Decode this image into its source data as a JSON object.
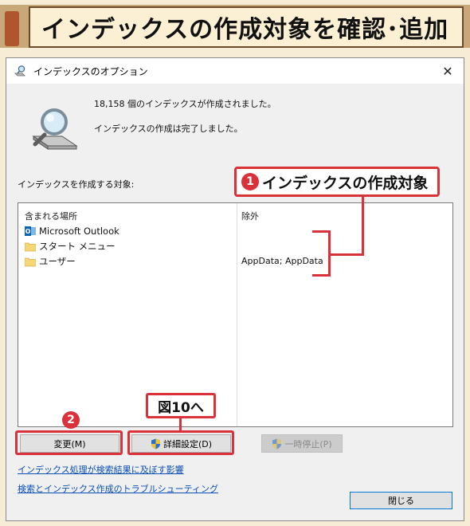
{
  "header": {
    "title": "インデックスの作成対象を確認･追加"
  },
  "window": {
    "title": "インデックスのオプション",
    "close_glyph": "✕",
    "status_count": "18,158 個のインデックスが作成されました。",
    "status_done": "インデックスの作成は完了しました。",
    "locations_label": "インデックスを作成する対象:"
  },
  "list": {
    "col_included": "含まれる場所",
    "col_excluded": "除外",
    "rows": [
      {
        "name": "Microsoft Outlook",
        "icon": "outlook-icon",
        "excluded": ""
      },
      {
        "name": "スタート メニュー",
        "icon": "folder-icon",
        "excluded": ""
      },
      {
        "name": "ユーザー",
        "icon": "folder-icon",
        "excluded": "AppData; AppData"
      }
    ]
  },
  "buttons": {
    "modify": "変更(M)",
    "advanced": "詳細設定(D)",
    "pause": "一時停止(P)",
    "close": "閉じる"
  },
  "links": {
    "affect": "インデックス処理が検索結果に及ぼす影響",
    "troubleshoot": "検索とインデックス作成のトラブルシューティング"
  },
  "annotations": {
    "callout1_num": "1",
    "callout1_text": "インデックスの作成対象",
    "callout2_num": "2",
    "figure_ref": "図10へ"
  },
  "colors": {
    "annotation_red": "#d9323b",
    "link_blue": "#0a4fb5",
    "header_brown": "#c8a778",
    "folder_yellow": "#f5d775"
  }
}
